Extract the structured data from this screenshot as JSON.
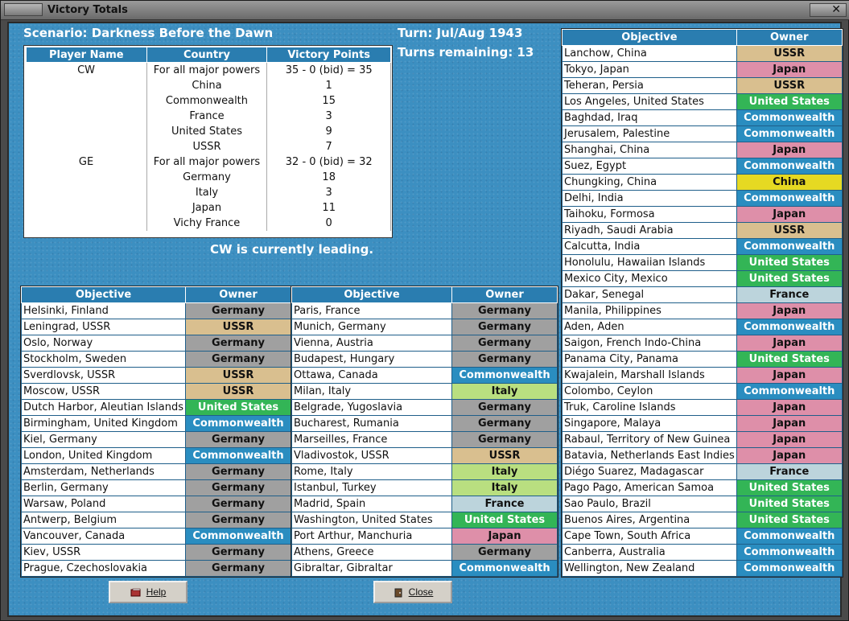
{
  "window": {
    "title": "Victory Totals",
    "close_glyph": "✕"
  },
  "header": {
    "scenario": "Scenario: Darkness Before the Dawn",
    "turn": "Turn: Jul/Aug 1943",
    "turns_remaining": "Turns remaining: 13",
    "leading": "CW is currently leading."
  },
  "summary": {
    "columns": [
      "Player Name",
      "Country",
      "Victory Points"
    ],
    "rows": [
      [
        "CW",
        "For all major powers",
        "35 - 0 (bid) = 35"
      ],
      [
        "",
        "China",
        "1"
      ],
      [
        "",
        "Commonwealth",
        "15"
      ],
      [
        "",
        "France",
        "3"
      ],
      [
        "",
        "United States",
        "9"
      ],
      [
        "",
        "USSR",
        "7"
      ],
      [
        "GE",
        "For all major powers",
        "32 - 0 (bid) = 32"
      ],
      [
        "",
        "Germany",
        "18"
      ],
      [
        "",
        "Italy",
        "3"
      ],
      [
        "",
        "Japan",
        "11"
      ],
      [
        "",
        "Vichy France",
        "0"
      ]
    ]
  },
  "objective_headers": {
    "objective": "Objective",
    "owner": "Owner"
  },
  "objectives_left": [
    [
      "Helsinki, Finland",
      "Germany"
    ],
    [
      "Leningrad, USSR",
      "USSR"
    ],
    [
      "Oslo, Norway",
      "Germany"
    ],
    [
      "Stockholm, Sweden",
      "Germany"
    ],
    [
      "Sverdlovsk, USSR",
      "USSR"
    ],
    [
      "Moscow, USSR",
      "USSR"
    ],
    [
      "Dutch Harbor, Aleutian Islands",
      "United States"
    ],
    [
      "Birmingham, United Kingdom",
      "Commonwealth"
    ],
    [
      "Kiel, Germany",
      "Germany"
    ],
    [
      "London, United Kingdom",
      "Commonwealth"
    ],
    [
      "Amsterdam, Netherlands",
      "Germany"
    ],
    [
      "Berlin, Germany",
      "Germany"
    ],
    [
      "Warsaw, Poland",
      "Germany"
    ],
    [
      "Antwerp, Belgium",
      "Germany"
    ],
    [
      "Vancouver, Canada",
      "Commonwealth"
    ],
    [
      "Kiev, USSR",
      "Germany"
    ],
    [
      "Prague, Czechoslovakia",
      "Germany"
    ]
  ],
  "objectives_middle": [
    [
      "Paris, France",
      "Germany"
    ],
    [
      "Munich, Germany",
      "Germany"
    ],
    [
      "Vienna, Austria",
      "Germany"
    ],
    [
      "Budapest, Hungary",
      "Germany"
    ],
    [
      "Ottawa, Canada",
      "Commonwealth"
    ],
    [
      "Milan, Italy",
      "Italy"
    ],
    [
      "Belgrade, Yugoslavia",
      "Germany"
    ],
    [
      "Bucharest, Rumania",
      "Germany"
    ],
    [
      "Marseilles, France",
      "Germany"
    ],
    [
      "Vladivostok, USSR",
      "USSR"
    ],
    [
      "Rome, Italy",
      "Italy"
    ],
    [
      "Istanbul, Turkey",
      "Italy"
    ],
    [
      "Madrid, Spain",
      "France"
    ],
    [
      "Washington, United States",
      "United States"
    ],
    [
      "Port Arthur, Manchuria",
      "Japan"
    ],
    [
      "Athens, Greece",
      "Germany"
    ],
    [
      "Gibraltar, Gibraltar",
      "Commonwealth"
    ]
  ],
  "objectives_right": [
    [
      "Lanchow, China",
      "USSR"
    ],
    [
      "Tokyo, Japan",
      "Japan"
    ],
    [
      "Teheran, Persia",
      "USSR"
    ],
    [
      "Los Angeles, United States",
      "United States"
    ],
    [
      "Baghdad, Iraq",
      "Commonwealth"
    ],
    [
      "Jerusalem, Palestine",
      "Commonwealth"
    ],
    [
      "Shanghai, China",
      "Japan"
    ],
    [
      "Suez, Egypt",
      "Commonwealth"
    ],
    [
      "Chungking, China",
      "China"
    ],
    [
      "Delhi, India",
      "Commonwealth"
    ],
    [
      "Taihoku, Formosa",
      "Japan"
    ],
    [
      "Riyadh, Saudi Arabia",
      "USSR"
    ],
    [
      "Calcutta, India",
      "Commonwealth"
    ],
    [
      "Honolulu, Hawaiian Islands",
      "United States"
    ],
    [
      "Mexico City, Mexico",
      "United States"
    ],
    [
      "Dakar, Senegal",
      "France"
    ],
    [
      "Manila, Philippines",
      "Japan"
    ],
    [
      "Aden, Aden",
      "Commonwealth"
    ],
    [
      "Saigon, French Indo-China",
      "Japan"
    ],
    [
      "Panama City, Panama",
      "United States"
    ],
    [
      "Kwajalein, Marshall Islands",
      "Japan"
    ],
    [
      "Colombo, Ceylon",
      "Commonwealth"
    ],
    [
      "Truk, Caroline Islands",
      "Japan"
    ],
    [
      "Singapore, Malaya",
      "Japan"
    ],
    [
      "Rabaul, Territory of New Guinea",
      "Japan"
    ],
    [
      "Batavia, Netherlands East Indies",
      "Japan"
    ],
    [
      "Diégo Suarez, Madagascar",
      "France"
    ],
    [
      "Pago Pago, American Samoa",
      "United States"
    ],
    [
      "Sao Paulo, Brazil",
      "United States"
    ],
    [
      "Buenos Aires, Argentina",
      "United States"
    ],
    [
      "Cape Town, South Africa",
      "Commonwealth"
    ],
    [
      "Canberra, Australia",
      "Commonwealth"
    ],
    [
      "Wellington, New Zealand",
      "Commonwealth"
    ]
  ],
  "buttons": {
    "help": "Help",
    "close": "Close"
  },
  "icons": {
    "help": "help-book-icon",
    "close": "close-door-icon"
  }
}
